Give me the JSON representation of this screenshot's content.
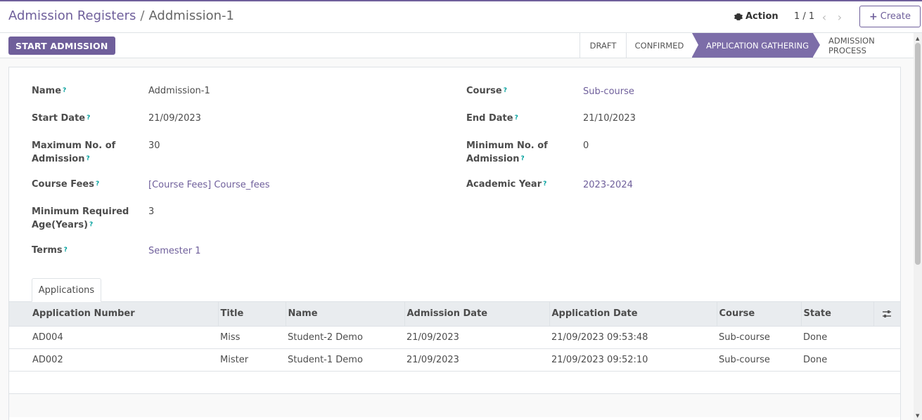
{
  "breadcrumb": {
    "parent": "Admission Registers",
    "separator": "/",
    "current": "Addmission-1"
  },
  "toolbar": {
    "action_label": "Action",
    "pager": "1 / 1",
    "create_label": "Create"
  },
  "statusbar": {
    "start_label": "START ADMISSION",
    "stages": [
      "DRAFT",
      "CONFIRMED",
      "APPLICATION GATHERING",
      "ADMISSION PROCESS"
    ],
    "active_stage": "APPLICATION GATHERING"
  },
  "form": {
    "name": {
      "label": "Name",
      "value": "Addmission-1"
    },
    "course": {
      "label": "Course",
      "value": "Sub-course"
    },
    "start_date": {
      "label": "Start Date",
      "value": "21/09/2023"
    },
    "end_date": {
      "label": "End Date",
      "value": "21/10/2023"
    },
    "max_admission": {
      "label_line1": "Maximum No. of",
      "label_line2": "Admission",
      "value": "30"
    },
    "min_admission": {
      "label_line1": "Minimum No. of",
      "label_line2": "Admission",
      "value": "0"
    },
    "course_fees": {
      "label": "Course Fees",
      "value": "[Course Fees] Course_fees"
    },
    "academic_year": {
      "label": "Academic Year",
      "value": "2023-2024"
    },
    "min_age": {
      "label_line1": "Minimum Required",
      "label_line2": "Age(Years)",
      "value": "3"
    },
    "terms": {
      "label": "Terms",
      "value": "Semester 1"
    },
    "help_mark": "?"
  },
  "tabs": {
    "applications": "Applications"
  },
  "applications": {
    "columns": [
      "Application Number",
      "Title",
      "Name",
      "Admission Date",
      "Application Date",
      "Course",
      "State"
    ],
    "rows": [
      {
        "number": "AD004",
        "title": "Miss",
        "name": "Student-2 Demo",
        "admission_date": "21/09/2023",
        "application_date": "21/09/2023 09:53:48",
        "course": "Sub-course",
        "state": "Done"
      },
      {
        "number": "AD002",
        "title": "Mister",
        "name": "Student-1 Demo",
        "admission_date": "21/09/2023",
        "application_date": "21/09/2023 09:52:10",
        "course": "Sub-course",
        "state": "Done"
      }
    ]
  },
  "colors": {
    "brand": "#6f5f9b",
    "active_stage": "#7c6da8",
    "help": "#00a09d"
  }
}
